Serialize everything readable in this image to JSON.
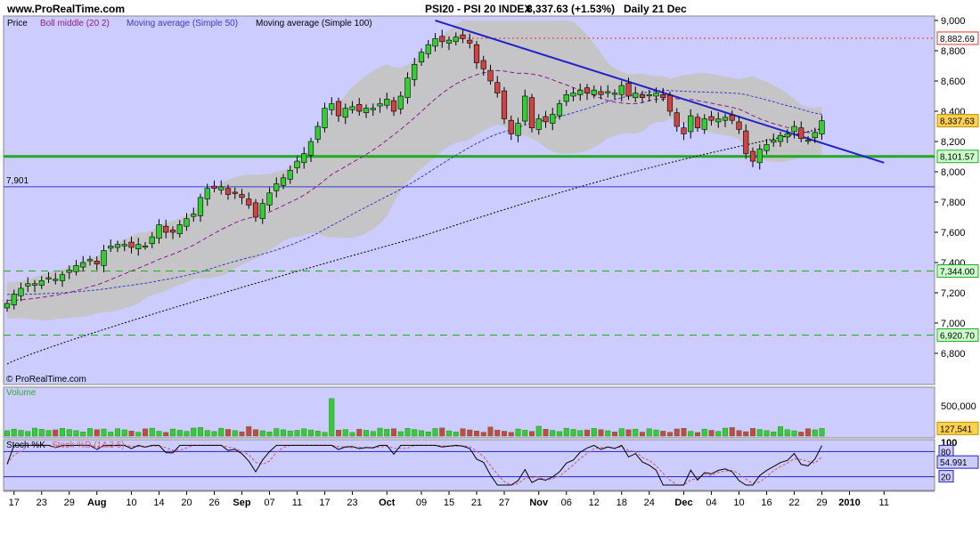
{
  "header": {
    "site": "www.ProRealTime.com",
    "title": "PSI20 - PSI 20 INDEX",
    "price_change": "8,337.63 (+1.53%)",
    "period_date": "Daily  21 Dec",
    "watermark": "© ProRealTime.com"
  },
  "legend": [
    {
      "label": "Price",
      "color": "#000000"
    },
    {
      "label": "Boll middle (20 2)",
      "color": "#8b1a8b"
    },
    {
      "label": "Moving average (Simple 50)",
      "color": "#3a3ad0"
    },
    {
      "label": "Moving average (Simple 100)",
      "color": "#000000"
    }
  ],
  "colors": {
    "background": "#ccccff",
    "bull": "#33cc33",
    "bear": "#cc4444",
    "bollinger_band": "#c4c4c4",
    "trendline": "#2222cc",
    "support": "#22aa22"
  },
  "chart_data": [
    {
      "type": "candlestick",
      "name": "price",
      "ylim": [
        6650,
        9050
      ],
      "y_ticks": [
        "9,000",
        "8,800",
        "8,600",
        "8,400",
        "8,200",
        "8,000",
        "7,800",
        "7,600",
        "7,400",
        "7,200",
        "7,000",
        "6,800"
      ],
      "y_tick_values": [
        9000,
        8800,
        8600,
        8400,
        8200,
        8000,
        7800,
        7600,
        7400,
        7200,
        7000,
        6800
      ],
      "x_labels": [
        "17",
        "23",
        "29",
        "Aug",
        "10",
        "14",
        "20",
        "26",
        "Sep",
        "07",
        "11",
        "17",
        "23",
        "Oct",
        "09",
        "15",
        "21",
        "27",
        "Nov",
        "06",
        "12",
        "18",
        "24",
        "Dec",
        "04",
        "10",
        "16",
        "22",
        "29",
        "2010",
        "11"
      ],
      "x_label_index": [
        1,
        5,
        9,
        13,
        18,
        22,
        26,
        30,
        34,
        38,
        42,
        46,
        50,
        55,
        60,
        64,
        68,
        72,
        77,
        81,
        85,
        89,
        93,
        98,
        102,
        106,
        110,
        114,
        118,
        122,
        127
      ],
      "close_series": [
        7130,
        7190,
        7230,
        7260,
        7260,
        7280,
        7300,
        7290,
        7320,
        7350,
        7380,
        7400,
        7420,
        7390,
        7480,
        7510,
        7520,
        7520,
        7500,
        7520,
        7510,
        7570,
        7650,
        7600,
        7600,
        7650,
        7690,
        7720,
        7830,
        7890,
        7890,
        7900,
        7850,
        7860,
        7830,
        7780,
        7700,
        7790,
        7860,
        7920,
        7960,
        8010,
        8070,
        8120,
        8200,
        8300,
        8420,
        8450,
        8370,
        8420,
        8430,
        8400,
        8420,
        8420,
        8450,
        8480,
        8400,
        8500,
        8620,
        8710,
        8790,
        8840,
        8880,
        8860,
        8870,
        8890,
        8880,
        8850,
        8720,
        8680,
        8600,
        8520,
        8350,
        8250,
        8320,
        8500,
        8290,
        8350,
        8330,
        8380,
        8450,
        8510,
        8520,
        8540,
        8520,
        8540,
        8510,
        8530,
        8520,
        8570,
        8500,
        8520,
        8490,
        8510,
        8520,
        8490,
        8400,
        8300,
        8250,
        8370,
        8290,
        8350,
        8340,
        8350,
        8360,
        8340,
        8280,
        8120,
        8070,
        8150,
        8180,
        8210,
        8240,
        8250,
        8300,
        8220,
        8210,
        8260,
        8337.63
      ],
      "open_first": 7100,
      "boll_middle_start": [
        7150,
        7260,
        7420,
        7650,
        8000,
        8350,
        8520
      ],
      "bands": {
        "upper_peak": 9000,
        "lower_min": 7170
      },
      "sma50_start": 7190,
      "sma100_start": 6730,
      "sma100_end": 8280,
      "trendline": {
        "from": {
          "index": 62,
          "value": 9000
        },
        "to": {
          "index": 127,
          "value": 8060
        }
      },
      "levels": [
        {
          "label": "8,882.69",
          "value": 8882.69,
          "style": "dotted",
          "color": "#e83030"
        },
        {
          "label": "8,101.57",
          "value": 8101.57,
          "style": "solid",
          "color": "#22aa22"
        },
        {
          "label": "7,901",
          "value": 7901,
          "style": "solid",
          "color": "#3a3ad0"
        },
        {
          "label": "7,344.00",
          "value": 7344,
          "style": "dashed",
          "color": "#22aa22"
        },
        {
          "label": "6,920.70",
          "value": 6920.7,
          "style": "dashed",
          "color": "#22aa22"
        }
      ],
      "current_price_label": "8,337.63"
    },
    {
      "type": "bar",
      "name": "Volume",
      "title": "Volume",
      "y_ticks": [
        "500,000"
      ],
      "y_tick_values": [
        500000
      ],
      "ylim": [
        0,
        650000
      ],
      "current_label": "127,541",
      "spike": {
        "index": 47,
        "value": 620000
      }
    },
    {
      "type": "line",
      "name": "Stoch",
      "title": "Stoch %K",
      "subtitle": "Stoch %D (14 3 5)",
      "ylim": [
        0,
        100
      ],
      "y_ticks": [
        "100",
        "80",
        "20"
      ],
      "y_tick_values": [
        100,
        80,
        20
      ],
      "current_label": "54.991"
    }
  ]
}
